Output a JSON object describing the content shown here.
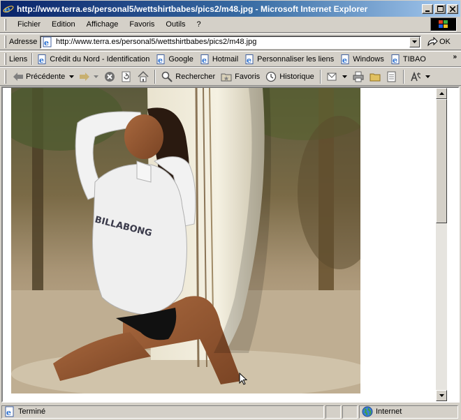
{
  "window": {
    "title": "http://www.terra.es/personal5/wettshirtbabes/pics2/m48.jpg - Microsoft Internet Explorer"
  },
  "menu": [
    "Fichier",
    "Edition",
    "Affichage",
    "Favoris",
    "Outils",
    "?"
  ],
  "address": {
    "label": "Adresse",
    "url": "http://www.terra.es/personal5/wettshirtbabes/pics2/m48.jpg",
    "go_label": "OK"
  },
  "links": {
    "label": "Liens",
    "items": [
      "Crédit du Nord - Identification",
      "Google",
      "Hotmail",
      "Personnaliser les liens",
      "Windows",
      "TIBAO"
    ]
  },
  "toolbar": {
    "back": "Précédente",
    "search": "Rechercher",
    "favorites": "Favoris",
    "history": "Historique"
  },
  "content": {
    "shirt_text": "BILLABONG"
  },
  "status": {
    "text": "Terminé",
    "zone": "Internet"
  }
}
